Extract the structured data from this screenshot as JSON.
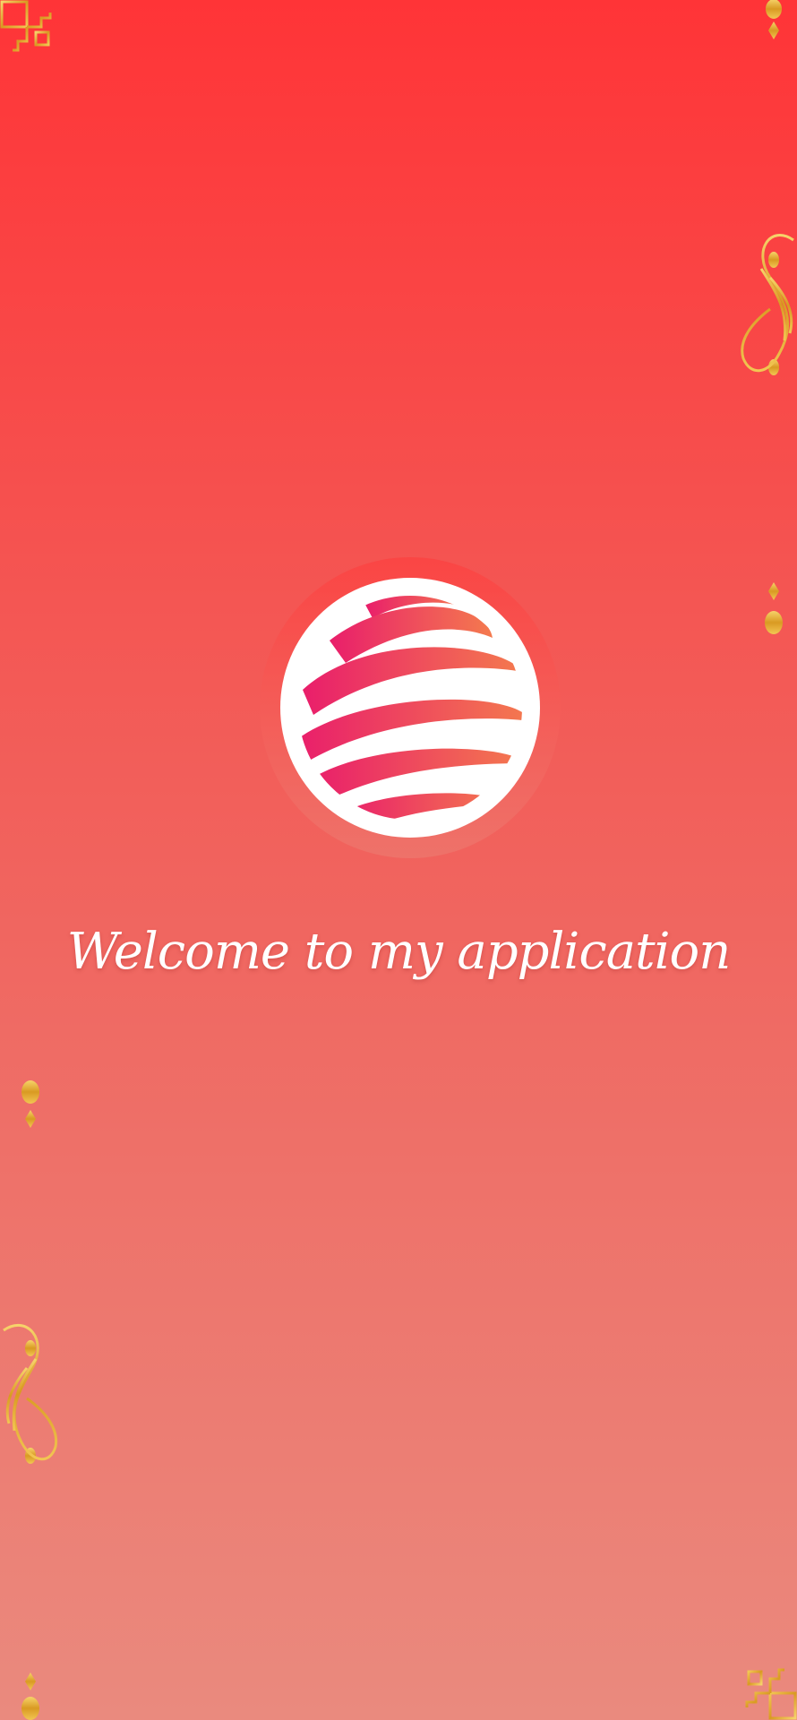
{
  "splash": {
    "welcome_text": "Welcome to my application"
  },
  "icons": {
    "logo": "globe-stripes-logo",
    "ornaments": [
      "corner-fretwork-top-left",
      "scroll-divider-right",
      "scroll-divider-left",
      "corner-fretwork-bottom-right"
    ]
  },
  "colors": {
    "background_top": "#ff3437",
    "background_bottom": "#ea8a7e",
    "gold": "#e8b83a",
    "logo_pink": "#e91e6b",
    "logo_orange": "#f47a4e",
    "text": "#ffffff"
  }
}
